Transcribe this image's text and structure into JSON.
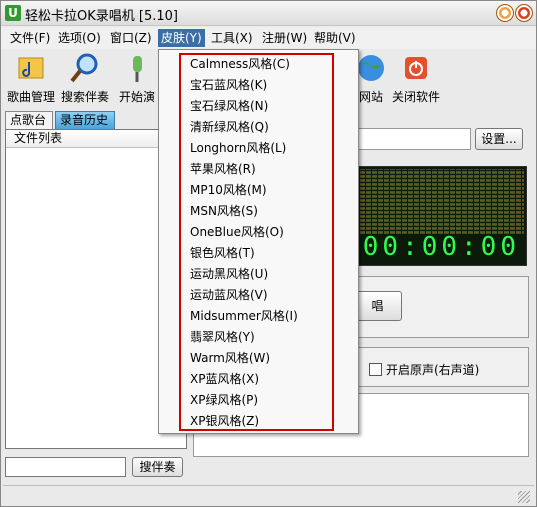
{
  "window": {
    "title": "轻松卡拉OK录唱机 [5.10]",
    "app_icon": "U"
  },
  "menubar": [
    {
      "label": "文件(F)",
      "name": "menu-file"
    },
    {
      "label": "选项(O)",
      "name": "menu-options"
    },
    {
      "label": "窗口(Z)",
      "name": "menu-window"
    },
    {
      "label": "皮肤(Y)",
      "name": "menu-skin"
    },
    {
      "label": "工具(X)",
      "name": "menu-tools"
    },
    {
      "label": "注册(W)",
      "name": "menu-register"
    },
    {
      "label": "帮助(V)",
      "name": "menu-help"
    }
  ],
  "toolbar": [
    {
      "label": "歌曲管理",
      "icon": "song-manage-icon"
    },
    {
      "label": "搜索伴奏",
      "icon": "magnifier-icon"
    },
    {
      "label": "开始演",
      "icon": "microphone-icon"
    },
    {
      "label": "网站",
      "icon": "globe-icon"
    },
    {
      "label": "关闭软件",
      "icon": "power-icon"
    }
  ],
  "tabs": [
    {
      "label": "点歌台",
      "active": false
    },
    {
      "label": "录音历史",
      "active": true
    }
  ],
  "list": {
    "header": "文件列表"
  },
  "search": {
    "button": "搜伴奏",
    "value": ""
  },
  "settings": {
    "button": "设置..."
  },
  "visualizer": {
    "timer": "00:00:00"
  },
  "sing_button": "唱",
  "original_voice": {
    "label": "开启原声(右声道)",
    "checked": false
  },
  "skin_menu": [
    "Calmness风格(C)",
    "宝石蓝风格(K)",
    "宝石绿风格(N)",
    "清新绿风格(Q)",
    "Longhorn风格(L)",
    "苹果风格(R)",
    "MP10风格(M)",
    "MSN风格(S)",
    "OneBlue风格(O)",
    "银色风格(T)",
    "运动黑风格(U)",
    "运动蓝风格(V)",
    "Midsummer风格(I)",
    "翡翠风格(Y)",
    "Warm风格(W)",
    "XP蓝风格(X)",
    "XP绿风格(P)",
    "XP银风格(Z)"
  ],
  "colors": {
    "highlight": "#d00000",
    "menu_active": "#3a6ea5",
    "timer": "#2cff4a"
  }
}
